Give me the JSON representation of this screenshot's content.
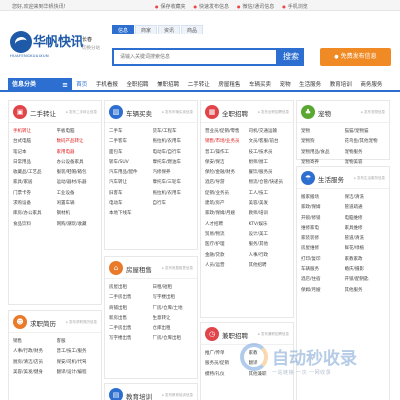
{
  "topbar": {
    "welcome": "您好,欢迎来到华帆快讯!",
    "links": [
      "保存收藏夹",
      "快速发布信息",
      "微信/通讯信息",
      "手机浏览"
    ]
  },
  "header": {
    "logo_cn": "华帆快讯",
    "logo_en": "HUAFENGKUAIXUN",
    "city": "长春",
    "city_switch": "切换分站",
    "search_tabs": [
      "信息",
      "商家",
      "资讯",
      "商品"
    ],
    "search_placeholder": "请输入关键词搜索信息",
    "search_button": "搜索",
    "post_button": "免费发布信息"
  },
  "nav": {
    "category_label": "信息分类",
    "items": [
      "首页",
      "手机看报",
      "全职招聘",
      "兼职招聘",
      "二手转让",
      "房屋租售",
      "车辆买卖",
      "宠物",
      "生活服务",
      "教育培训",
      "商务服务"
    ],
    "active_index": 0
  },
  "panels": {
    "secondhand": {
      "title": "二手转让",
      "link": "发布二手转让信息",
      "icon": "shopping-bag-icon",
      "color": "#e0454a",
      "items": [
        {
          "text": "手机转让",
          "red": true
        },
        {
          "text": "平板电脑",
          "red": false
        },
        {
          "text": "台式电脑",
          "red": false
        },
        {
          "text": "数码产品转让",
          "red": true
        },
        {
          "text": "笔记本",
          "red": false
        },
        {
          "text": "家用电器",
          "red": true
        },
        {
          "text": "日常用品",
          "red": false
        },
        {
          "text": "办公设备家具",
          "red": false
        },
        {
          "text": "收藏品/工艺品",
          "red": false
        },
        {
          "text": "服装/鞋帽/箱包",
          "red": false
        },
        {
          "text": "家具/家居",
          "red": false
        },
        {
          "text": "运动/器材/乐器",
          "red": false
        },
        {
          "text": "门票卡券",
          "red": false
        },
        {
          "text": "工业设备",
          "red": false
        },
        {
          "text": "求购设备",
          "red": false
        },
        {
          "text": "闲置车辆",
          "red": false
        },
        {
          "text": "库房/办公家具",
          "red": false
        },
        {
          "text": "钢材机",
          "red": false
        },
        {
          "text": "食品饮料",
          "red": false
        },
        {
          "text": "网购/潮玩/收藏",
          "red": false
        }
      ]
    },
    "cars": {
      "title": "车辆买卖",
      "link": "发布车辆买卖信息",
      "icon": "car-icon",
      "color": "#2d6fd0",
      "items": [
        "二手车",
        "货车/工程车",
        "二手客车",
        "拖拉机/农用车",
        "面包车",
        "电动车/自行车",
        "轿车/SUV",
        "摩托车/燃油车",
        "汽车用品/配件",
        "汽修保养",
        "汽车转让",
        "摩托车/三轮车",
        "旧客车",
        "拖拉机/农用车",
        "电动车",
        "自行车",
        "本地下线车",
        ""
      ]
    },
    "house": {
      "title": "房屋租售",
      "link": "发布房屋租售信息",
      "icon": "house-icon",
      "color": "#e87a2a",
      "items": [
        "房屋出租",
        "日租/短租",
        "二手房出售",
        "写字楼出租",
        "商铺出租",
        "厂房/仓库/土地",
        "新房出售",
        "生意转让",
        "二手房出售",
        "仓库出租",
        "写字楼出售",
        "厂房/仓库出租"
      ]
    },
    "jobs": {
      "title": "全职招聘",
      "link": "发布全职招聘信息",
      "icon": "briefcase-icon",
      "color": "#e0454a",
      "items": [
        {
          "text": "营业员/促销/零售",
          "red": false
        },
        {
          "text": "司机/交通运输",
          "red": false
        },
        {
          "text": "销售/市场/业务员",
          "red": true
        },
        {
          "text": "文员/客服/前台",
          "red": false
        },
        {
          "text": "普工/操作工",
          "red": false
        },
        {
          "text": "技工/技术员",
          "red": false
        },
        {
          "text": "保安/保洁",
          "red": false
        },
        {
          "text": "厨师/厨工",
          "red": false
        },
        {
          "text": "保险/金融/财务",
          "red": false
        },
        {
          "text": "餐饮/服务员",
          "red": false
        },
        {
          "text": "酒店/导游",
          "red": false
        },
        {
          "text": "物流/仓管/快递员",
          "red": false
        },
        {
          "text": "促销/业务员",
          "red": false
        },
        {
          "text": "工人/技工",
          "red": false
        },
        {
          "text": "建筑/房产",
          "red": false
        },
        {
          "text": "美容/美发",
          "red": false
        },
        {
          "text": "家政/保姆/月嫂",
          "red": false
        },
        {
          "text": "教师/培训",
          "red": false
        },
        {
          "text": "人才招聘",
          "red": false
        },
        {
          "text": "KTV/娱乐",
          "red": false
        },
        {
          "text": "贸易/物流",
          "red": false
        },
        {
          "text": "设计/美工",
          "red": false
        },
        {
          "text": "医疗/护理",
          "red": false
        },
        {
          "text": "服务/其他",
          "red": false
        },
        {
          "text": "金融/贷款",
          "red": false
        },
        {
          "text": "人事/行政",
          "red": false
        },
        {
          "text": "人员/运营",
          "red": false
        },
        {
          "text": "其他招聘",
          "red": false
        }
      ]
    },
    "parttime": {
      "title": "兼职招聘",
      "link": "发布兼职招聘信息",
      "icon": "clock-icon",
      "color": "#e0454a",
      "items": [
        "推广/传单",
        "家教",
        "服务员/促销",
        "翻译",
        "模特/礼仪",
        "其他兼职"
      ]
    },
    "pets": {
      "title": "宠物",
      "link": "发布宠物信息",
      "icon": "paw-icon",
      "color": "#5aa832",
      "items": [
        "宠物",
        "猫猫/宠物猫",
        "宠物狗",
        "花鸟鱼/其他宠物",
        "宠物用品/食品",
        "宠物服务",
        "宠物寄养",
        "宠物美容"
      ]
    },
    "life": {
      "title": "生活服务",
      "link": "发布生活服务信息",
      "icon": "umbrella-icon",
      "color": "#2d6fd0",
      "items": [
        "搬家搬场",
        "保洁/清洗",
        "家政/保姆",
        "管道疏通",
        "开锁/修锁",
        "电脑维修",
        "维修家电",
        "家具维修",
        "家装装修",
        "管道/清洗",
        "房屋维修",
        "鲜花/绿植",
        "打印/复印",
        "家教家政",
        "车辆服务",
        "婚庆/摄影",
        "酒店/住宿",
        "开锁/配钥匙",
        "保姆/月嫂",
        "其他服务"
      ]
    },
    "education": {
      "title": "教育培训",
      "link": "发布教育培训信息",
      "icon": "book-icon",
      "color": "#2d6fd0",
      "items": []
    },
    "resume": {
      "title": "求职简历",
      "link": "发布求职简历信息",
      "icon": "person-icon",
      "color": "#e87a2a",
      "items": [
        "销售",
        "客服",
        "人事/行政/财务",
        "普工/技工/服务",
        "厨房/清洁/店员",
        "保安/司机/代驾",
        "美容/美发/健身",
        "翻译/设计/编程"
      ]
    }
  },
  "watermark": {
    "text": "自动秒收录",
    "sub": "一站链接·一次·一网收录"
  }
}
